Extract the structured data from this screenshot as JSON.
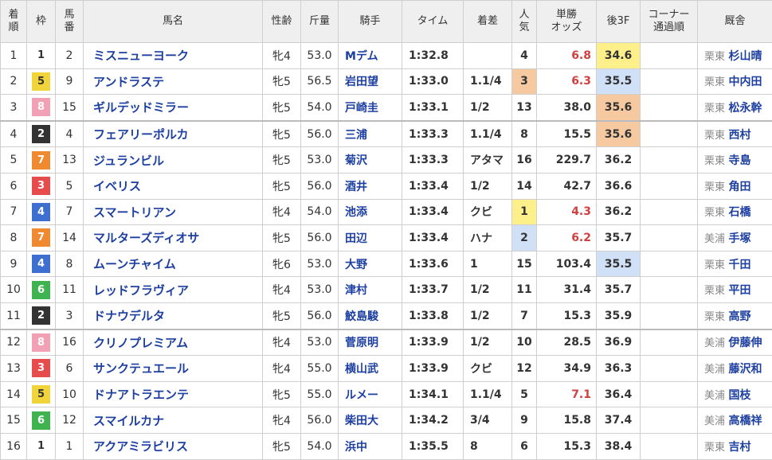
{
  "headers": {
    "rank": [
      "着",
      "順"
    ],
    "frame": "枠",
    "num": [
      "馬",
      "番"
    ],
    "name": "馬名",
    "sexage": "性齢",
    "weight": "斤量",
    "jockey": "騎手",
    "time": "タイム",
    "margin": "着差",
    "pop": [
      "人",
      "気"
    ],
    "odds": [
      "単勝",
      "オッズ"
    ],
    "last3f": "後3F",
    "corner": [
      "コーナー",
      "通過順"
    ],
    "stable": "厩舎"
  },
  "frame_colors": {
    "1": {
      "bg": "#ffffff",
      "fg": "#333333"
    },
    "2": {
      "bg": "#333333",
      "fg": "#ffffff"
    },
    "3": {
      "bg": "#e74c4c",
      "fg": "#ffffff"
    },
    "4": {
      "bg": "#3d6fd0",
      "fg": "#ffffff"
    },
    "5": {
      "bg": "#f0d43a",
      "fg": "#333333"
    },
    "6": {
      "bg": "#3fb34f",
      "fg": "#ffffff"
    },
    "7": {
      "bg": "#f08a30",
      "fg": "#ffffff"
    },
    "8": {
      "bg": "#f2a0b4",
      "fg": "#ffffff"
    }
  },
  "highlight_colors": {
    "gold": "#fdf08a",
    "silver": "#cfe0f7",
    "bronze": "#f6c9a0"
  },
  "rows": [
    {
      "rank": "1",
      "frame": "1",
      "num": "2",
      "name": "ミスニューヨーク",
      "sexage": "牝4",
      "weight": "53.0",
      "jockey": "Mデム",
      "time": "1:32.8",
      "margin": "",
      "pop": "4",
      "odds": "6.8",
      "odds_hot": true,
      "last3f": "34.6",
      "last3f_hl": "gold",
      "pop_hl": "",
      "corner": "",
      "loc": "栗東",
      "trainer": "杉山晴"
    },
    {
      "rank": "2",
      "frame": "5",
      "num": "9",
      "name": "アンドラステ",
      "sexage": "牝5",
      "weight": "56.5",
      "jockey": "岩田望",
      "time": "1:33.0",
      "margin": "1.1/4",
      "pop": "3",
      "odds": "6.3",
      "odds_hot": true,
      "last3f": "35.5",
      "last3f_hl": "silver",
      "pop_hl": "bronze",
      "corner": "",
      "loc": "栗東",
      "trainer": "中内田"
    },
    {
      "rank": "3",
      "frame": "8",
      "num": "15",
      "name": "ギルデッドミラー",
      "sexage": "牝5",
      "weight": "54.0",
      "jockey": "戸崎圭",
      "time": "1:33.1",
      "margin": "1/2",
      "pop": "13",
      "odds": "38.0",
      "odds_hot": false,
      "last3f": "35.6",
      "last3f_hl": "bronze",
      "pop_hl": "",
      "corner": "",
      "loc": "栗東",
      "trainer": "松永幹"
    },
    {
      "rank": "4",
      "frame": "2",
      "num": "4",
      "name": "フェアリーポルカ",
      "sexage": "牝5",
      "weight": "56.0",
      "jockey": "三浦",
      "time": "1:33.3",
      "margin": "1.1/4",
      "pop": "8",
      "odds": "15.5",
      "odds_hot": false,
      "last3f": "35.6",
      "last3f_hl": "bronze",
      "pop_hl": "",
      "corner": "",
      "loc": "栗東",
      "trainer": "西村"
    },
    {
      "rank": "5",
      "frame": "7",
      "num": "13",
      "name": "ジュランビル",
      "sexage": "牝5",
      "weight": "53.0",
      "jockey": "菊沢",
      "time": "1:33.3",
      "margin": "アタマ",
      "pop": "16",
      "odds": "229.7",
      "odds_hot": false,
      "last3f": "36.2",
      "last3f_hl": "",
      "pop_hl": "",
      "corner": "",
      "loc": "栗東",
      "trainer": "寺島"
    },
    {
      "rank": "6",
      "frame": "3",
      "num": "5",
      "name": "イベリス",
      "sexage": "牝5",
      "weight": "56.0",
      "jockey": "酒井",
      "time": "1:33.4",
      "margin": "1/2",
      "pop": "14",
      "odds": "42.7",
      "odds_hot": false,
      "last3f": "36.6",
      "last3f_hl": "",
      "pop_hl": "",
      "corner": "",
      "loc": "栗東",
      "trainer": "角田"
    },
    {
      "rank": "7",
      "frame": "4",
      "num": "7",
      "name": "スマートリアン",
      "sexage": "牝4",
      "weight": "54.0",
      "jockey": "池添",
      "time": "1:33.4",
      "margin": "クビ",
      "pop": "1",
      "odds": "4.3",
      "odds_hot": true,
      "last3f": "36.2",
      "last3f_hl": "",
      "pop_hl": "gold",
      "corner": "",
      "loc": "栗東",
      "trainer": "石橋"
    },
    {
      "rank": "8",
      "frame": "7",
      "num": "14",
      "name": "マルターズディオサ",
      "sexage": "牝5",
      "weight": "56.0",
      "jockey": "田辺",
      "time": "1:33.4",
      "margin": "ハナ",
      "pop": "2",
      "odds": "6.2",
      "odds_hot": true,
      "last3f": "35.7",
      "last3f_hl": "",
      "pop_hl": "silver",
      "corner": "",
      "loc": "美浦",
      "trainer": "手塚"
    },
    {
      "rank": "9",
      "frame": "4",
      "num": "8",
      "name": "ムーンチャイム",
      "sexage": "牝6",
      "weight": "53.0",
      "jockey": "大野",
      "time": "1:33.6",
      "margin": "1",
      "pop": "15",
      "odds": "103.4",
      "odds_hot": false,
      "last3f": "35.5",
      "last3f_hl": "silver",
      "pop_hl": "",
      "corner": "",
      "loc": "栗東",
      "trainer": "千田"
    },
    {
      "rank": "10",
      "frame": "6",
      "num": "11",
      "name": "レッドフラヴィア",
      "sexage": "牝4",
      "weight": "53.0",
      "jockey": "津村",
      "time": "1:33.7",
      "margin": "1/2",
      "pop": "11",
      "odds": "31.4",
      "odds_hot": false,
      "last3f": "35.7",
      "last3f_hl": "",
      "pop_hl": "",
      "corner": "",
      "loc": "栗東",
      "trainer": "平田"
    },
    {
      "rank": "11",
      "frame": "2",
      "num": "3",
      "name": "ドナウデルタ",
      "sexage": "牝5",
      "weight": "56.0",
      "jockey": "鮫島駿",
      "time": "1:33.8",
      "margin": "1/2",
      "pop": "7",
      "odds": "15.3",
      "odds_hot": false,
      "last3f": "35.9",
      "last3f_hl": "",
      "pop_hl": "",
      "corner": "",
      "loc": "栗東",
      "trainer": "高野"
    },
    {
      "rank": "12",
      "frame": "8",
      "num": "16",
      "name": "クリノプレミアム",
      "sexage": "牝4",
      "weight": "53.0",
      "jockey": "菅原明",
      "time": "1:33.9",
      "margin": "1/2",
      "pop": "10",
      "odds": "28.5",
      "odds_hot": false,
      "last3f": "36.9",
      "last3f_hl": "",
      "pop_hl": "",
      "corner": "",
      "loc": "美浦",
      "trainer": "伊藤伸"
    },
    {
      "rank": "13",
      "frame": "3",
      "num": "6",
      "name": "サンクテュエール",
      "sexage": "牝4",
      "weight": "55.0",
      "jockey": "横山武",
      "time": "1:33.9",
      "margin": "クビ",
      "pop": "12",
      "odds": "34.9",
      "odds_hot": false,
      "last3f": "36.3",
      "last3f_hl": "",
      "pop_hl": "",
      "corner": "",
      "loc": "美浦",
      "trainer": "藤沢和"
    },
    {
      "rank": "14",
      "frame": "5",
      "num": "10",
      "name": "ドナアトラエンテ",
      "sexage": "牝5",
      "weight": "55.0",
      "jockey": "ルメー",
      "time": "1:34.1",
      "margin": "1.1/4",
      "pop": "5",
      "odds": "7.1",
      "odds_hot": true,
      "last3f": "36.4",
      "last3f_hl": "",
      "pop_hl": "",
      "corner": "",
      "loc": "美浦",
      "trainer": "国枝"
    },
    {
      "rank": "15",
      "frame": "6",
      "num": "12",
      "name": "スマイルカナ",
      "sexage": "牝4",
      "weight": "56.0",
      "jockey": "柴田大",
      "time": "1:34.2",
      "margin": "3/4",
      "pop": "9",
      "odds": "15.8",
      "odds_hot": false,
      "last3f": "37.4",
      "last3f_hl": "",
      "pop_hl": "",
      "corner": "",
      "loc": "美浦",
      "trainer": "高橋祥"
    },
    {
      "rank": "16",
      "frame": "1",
      "num": "1",
      "name": "アクアミラビリス",
      "sexage": "牝5",
      "weight": "54.0",
      "jockey": "浜中",
      "time": "1:35.5",
      "margin": "8",
      "pop": "6",
      "odds": "15.3",
      "odds_hot": false,
      "last3f": "38.4",
      "last3f_hl": "",
      "pop_hl": "",
      "corner": "",
      "loc": "栗東",
      "trainer": "吉村"
    }
  ]
}
